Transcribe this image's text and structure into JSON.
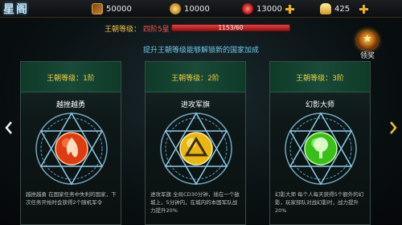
{
  "header": {
    "title": "星阁",
    "resources": [
      {
        "icon": "gem-chest-icon",
        "value": "50000"
      },
      {
        "icon": "copper-coin-icon",
        "value": "10000"
      },
      {
        "icon": "ruby-icon",
        "value": "13000"
      },
      {
        "icon": "gold-ingot-icon",
        "value": "425"
      }
    ]
  },
  "level": {
    "label": "王朝等级：",
    "value": "四阶5星",
    "progress_text": "1153/60",
    "progress": 1.0
  },
  "hint": "提升王朝等级能够解锁新的国家加成",
  "reward": {
    "label": "领奖"
  },
  "cards": [
    {
      "level_label": "王朝等级：1阶",
      "name": "越挫越勇",
      "description": "越挫越勇 在国家任务中失利的国家，下次任务开始时会获得2个随机军令",
      "orb_color": "#e03a10",
      "orb_icon": "flame-icon"
    },
    {
      "level_label": "王朝等级：2阶",
      "name": "进攻军旗",
      "description": "进攻军旗 全局CD30分钟，插在一个敌城上，5分钟内，在城内的本国军队战力提升20%",
      "orb_color": "#e8b810",
      "orb_icon": "triangle-flag-icon"
    },
    {
      "level_label": "王朝等级：3阶",
      "name": "幻影大师",
      "description": "幻影大师 每个人每天获得5个额外的幻影，玩家部队对战幻影时，战力提升20%",
      "orb_color": "#38c018",
      "orb_icon": "tree-icon"
    }
  ],
  "colors": {
    "accent_gold": "#f0c040",
    "hint_blue": "#6ec8e8",
    "progress_red": "#e24040"
  }
}
